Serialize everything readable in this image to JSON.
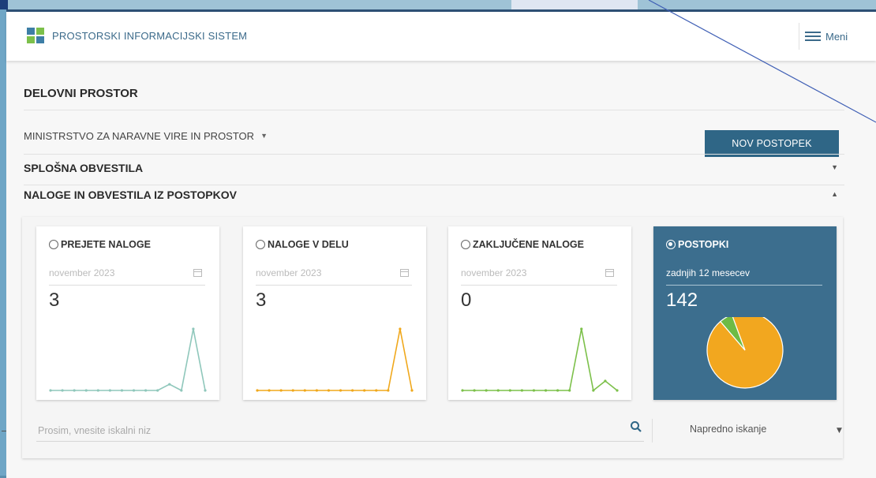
{
  "header": {
    "app_title": "PROSTORSKI INFORMACIJSKI SISTEM",
    "menu_label": "Meni"
  },
  "workspace": {
    "title": "DELOVNI PROSTOR",
    "department": "MINISTRSTVO ZA NARAVNE VIRE IN PROSTOR",
    "new_procedure_button": "NOV POSTOPEK"
  },
  "sections": {
    "general_notices": "SPLOŠNA OBVESTILA",
    "tasks_notices": "NALOGE IN OBVESTILA IZ POSTOPKOV"
  },
  "cards": [
    {
      "label": "PREJETE NALOGE",
      "date": "november 2023",
      "count": "3",
      "selected": false,
      "color": "#8fc7bb",
      "spark": [
        0,
        0,
        0,
        0,
        0,
        0,
        0,
        0,
        0,
        0,
        1,
        0,
        10,
        0
      ]
    },
    {
      "label": "NALOGE V DELU",
      "date": "november 2023",
      "count": "3",
      "selected": false,
      "color": "#f0a81c",
      "spark": [
        0,
        0,
        0,
        0,
        0,
        0,
        0,
        0,
        0,
        0,
        0,
        0,
        11,
        0
      ]
    },
    {
      "label": "ZAKLJUČENE NALOGE",
      "date": "november 2023",
      "count": "0",
      "selected": false,
      "color": "#7cc04a",
      "spark": [
        0,
        0,
        0,
        0,
        0,
        0,
        0,
        0,
        0,
        0,
        13,
        0,
        2,
        0
      ]
    },
    {
      "label": "POSTOPKI",
      "date": "zadnjih 12 mesecev",
      "count": "142",
      "selected": true,
      "pie": [
        {
          "value": 134,
          "color": "#f2a71f"
        },
        {
          "value": 8,
          "color": "#6dbb45"
        }
      ]
    }
  ],
  "search": {
    "placeholder": "Prosim, vnesite iskalni niz",
    "advanced_label": "Napredno iskanje"
  },
  "colors": {
    "accent": "#2f6686",
    "card_dark": "#3c6e8e"
  }
}
